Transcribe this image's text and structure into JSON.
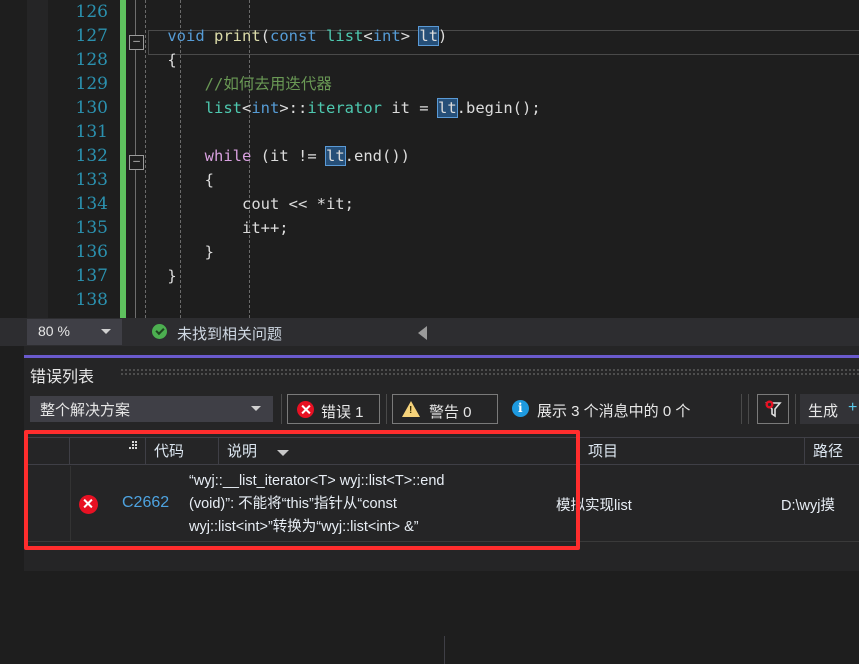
{
  "editor": {
    "zoom_level": "80 %",
    "status_message": "未找到相关问题",
    "status_icon": "check-circle-icon",
    "line_numbers": [
      "126",
      "127",
      "128",
      "129",
      "130",
      "131",
      "132",
      "133",
      "134",
      "135",
      "136",
      "137",
      "138"
    ],
    "lines": [
      {
        "num": "126",
        "tokens": []
      },
      {
        "num": "127",
        "tokens": [
          {
            "t": "    ",
            "c": "pl"
          },
          {
            "t": "void",
            "c": "kw"
          },
          {
            "t": " ",
            "c": "pl"
          },
          {
            "t": "print",
            "c": "fn"
          },
          {
            "t": "(",
            "c": "pl"
          },
          {
            "t": "const",
            "c": "kw"
          },
          {
            "t": " ",
            "c": "pl"
          },
          {
            "t": "list",
            "c": "typ"
          },
          {
            "t": "<",
            "c": "pl"
          },
          {
            "t": "int",
            "c": "kw"
          },
          {
            "t": "> ",
            "c": "pl"
          },
          {
            "t": "lt",
            "c": "sel"
          },
          {
            "t": ")",
            "c": "pl"
          }
        ]
      },
      {
        "num": "128",
        "tokens": [
          {
            "t": "    {",
            "c": "pl"
          }
        ]
      },
      {
        "num": "129",
        "tokens": [
          {
            "t": "        //如何去用迭代器",
            "c": "cmt"
          }
        ]
      },
      {
        "num": "130",
        "tokens": [
          {
            "t": "        ",
            "c": "pl"
          },
          {
            "t": "list",
            "c": "typ"
          },
          {
            "t": "<",
            "c": "pl"
          },
          {
            "t": "int",
            "c": "kw"
          },
          {
            "t": ">::",
            "c": "pl"
          },
          {
            "t": "iterator",
            "c": "typ"
          },
          {
            "t": " it = ",
            "c": "pl"
          },
          {
            "t": "lt",
            "c": "sel"
          },
          {
            "t": ".",
            "c": "pl"
          },
          {
            "t": "begin",
            "c": "pl"
          },
          {
            "t": "();",
            "c": "pl"
          }
        ]
      },
      {
        "num": "131",
        "tokens": []
      },
      {
        "num": "132",
        "tokens": [
          {
            "t": "        ",
            "c": "pl"
          },
          {
            "t": "while",
            "c": "kwc"
          },
          {
            "t": " (it != ",
            "c": "pl"
          },
          {
            "t": "lt",
            "c": "sel"
          },
          {
            "t": ".",
            "c": "pl"
          },
          {
            "t": "end",
            "c": "pl"
          },
          {
            "t": "())",
            "c": "pl"
          }
        ]
      },
      {
        "num": "133",
        "tokens": [
          {
            "t": "        {",
            "c": "pl"
          }
        ]
      },
      {
        "num": "134",
        "tokens": [
          {
            "t": "            cout << *it;",
            "c": "pl"
          }
        ]
      },
      {
        "num": "135",
        "tokens": [
          {
            "t": "            it++;",
            "c": "pl"
          }
        ]
      },
      {
        "num": "136",
        "tokens": [
          {
            "t": "        }",
            "c": "pl"
          }
        ]
      },
      {
        "num": "137",
        "tokens": [
          {
            "t": "    }",
            "c": "pl"
          }
        ]
      },
      {
        "num": "138",
        "tokens": []
      }
    ],
    "collapse_glyph": "–"
  },
  "panel": {
    "title": "错误列表",
    "scope_filter": {
      "value": "整个解决方案",
      "caret_icon": "chevron-down-icon"
    },
    "toolbar": {
      "errors": {
        "label": "错误 1",
        "icon": "error-circle-icon"
      },
      "warnings": {
        "label": "警告 0",
        "icon": "warning-triangle-icon",
        "glyph": "!"
      },
      "messages": {
        "label": "展示 3 个消息中的 0 个",
        "icon": "info-circle-icon",
        "glyph": "i"
      },
      "filter": {
        "icon": "filter-funnel-icon"
      },
      "build": {
        "label": "生成",
        "plus": "+",
        "icon": "build-icon"
      }
    },
    "table": {
      "columns": [
        {
          "key": "grip",
          "label": "",
          "name": "column-header-grip"
        },
        {
          "key": "code",
          "label": "代码",
          "name": "column-header-code"
        },
        {
          "key": "desc",
          "label": "说明",
          "name": "column-header-description",
          "sorted": true
        },
        {
          "key": "project",
          "label": "项目",
          "name": "column-header-project"
        },
        {
          "key": "path",
          "label": "路径",
          "name": "column-header-path"
        }
      ],
      "rows": [
        {
          "severity_icon": "error-circle-icon",
          "code": "C2662",
          "description_lines": [
            "“wyj::__list_iterator<T> wyj::list<T>::end",
            "(void)”: 不能将“this”指针从“const",
            "wyj::list<int>”转换为“wyj::list<int> &”"
          ],
          "project": "模拟实现list",
          "path": "D:\\wyj摸"
        }
      ]
    }
  },
  "annotation": {
    "color": "#ff2d2d",
    "shape": "rectangle"
  },
  "colors": {
    "editor_bg": "#1e1e1e",
    "panel_bg": "#252526",
    "accent_purple": "#6a5acd",
    "change_bar_green": "#5ec15e",
    "error_red": "#e81123",
    "warning_yellow": "#f5d27a",
    "info_blue": "#1e9ae0",
    "link_blue": "#4ea3e0",
    "linenum_blue": "#2b91af"
  }
}
